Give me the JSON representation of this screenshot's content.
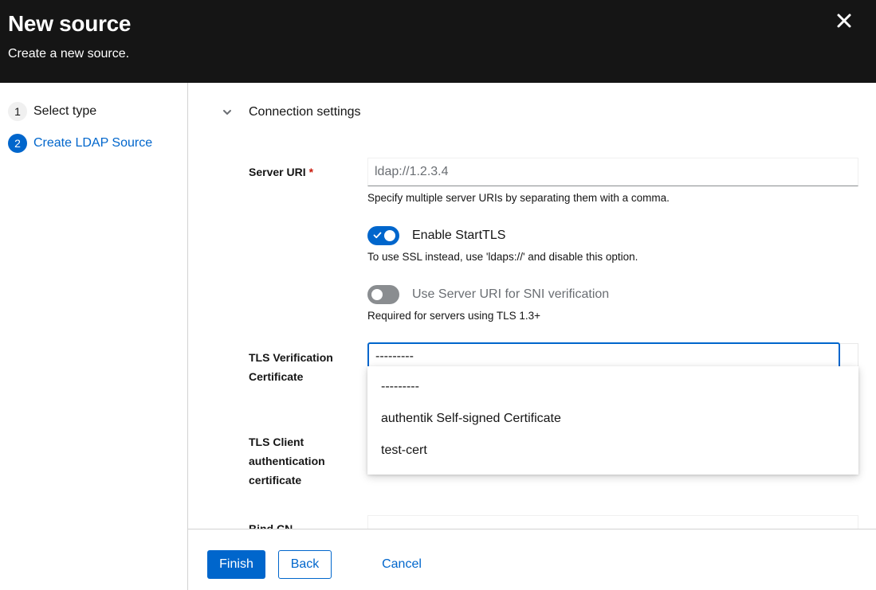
{
  "header": {
    "title": "New source",
    "subtitle": "Create a new source.",
    "close_icon": "close-icon"
  },
  "wizard": {
    "steps": [
      {
        "number": "1",
        "label": "Select type",
        "active": false
      },
      {
        "number": "2",
        "label": "Create LDAP Source",
        "active": true
      }
    ]
  },
  "form": {
    "section_title": "Connection settings",
    "server_uri": {
      "label": "Server URI",
      "required_mark": "*",
      "placeholder": "ldap://1.2.3.4",
      "helper": "Specify multiple server URIs by separating them with a comma."
    },
    "start_tls": {
      "label": "Enable StartTLS",
      "enabled": true,
      "helper": "To use SSL instead, use 'ldaps://' and disable this option."
    },
    "sni": {
      "label": "Use Server URI for SNI verification",
      "enabled": false,
      "helper": "Required for servers using TLS 1.3+"
    },
    "tls_verification": {
      "label_line1": "TLS Verification",
      "label_line2": "Certificate",
      "selected": "---------",
      "options": [
        "---------",
        "authentik Self-signed Certificate",
        "test-cert"
      ]
    },
    "tls_client": {
      "label_line1": "TLS Client",
      "label_line2": "authentication",
      "label_line3": "certificate"
    },
    "bind_cn": {
      "label": "Bind CN"
    }
  },
  "footer": {
    "finish_label": "Finish",
    "back_label": "Back",
    "cancel_label": "Cancel"
  },
  "colors": {
    "accent": "#0066cc",
    "header_bg": "#151515",
    "required": "#c9190b"
  }
}
